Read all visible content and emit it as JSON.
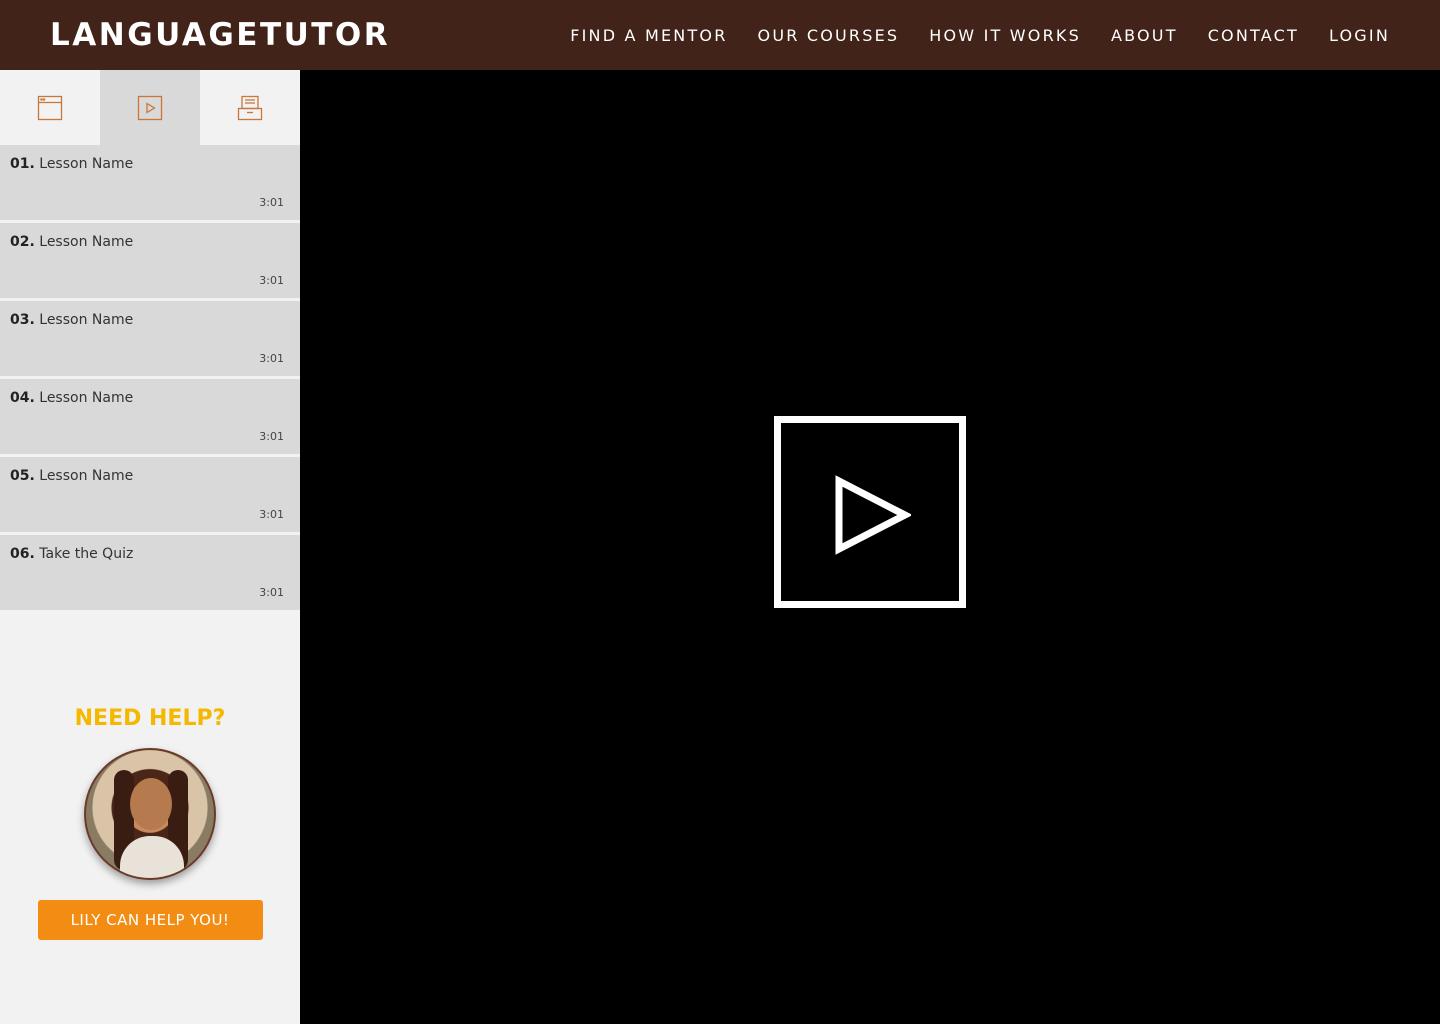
{
  "header": {
    "brand": "LANGUAGETUTOR",
    "nav": [
      "FIND A MENTOR",
      "OUR COURSES",
      "HOW IT WORKS",
      "ABOUT",
      "CONTACT",
      "LOGIN"
    ]
  },
  "sidebar": {
    "tabs": [
      {
        "icon": "browser-window-icon",
        "active": false
      },
      {
        "icon": "video-play-icon",
        "active": true
      },
      {
        "icon": "document-stack-icon",
        "active": false
      }
    ],
    "lessons": [
      {
        "number": "01.",
        "name": "Lesson Name",
        "duration": "3:01"
      },
      {
        "number": "02.",
        "name": "Lesson Name",
        "duration": "3:01"
      },
      {
        "number": "03.",
        "name": "Lesson Name",
        "duration": "3:01"
      },
      {
        "number": "04.",
        "name": "Lesson Name",
        "duration": "3:01"
      },
      {
        "number": "05.",
        "name": "Lesson Name",
        "duration": "3:01"
      },
      {
        "number": "06.",
        "name": "Take the Quiz",
        "duration": "3:01"
      }
    ],
    "help": {
      "title": "NEED HELP?",
      "button_label": "LILY CAN HELP YOU!"
    }
  },
  "colors": {
    "header_bg": "#41231a",
    "accent_orange": "#f28c12",
    "help_title": "#f5b800",
    "icon_color": "#c8763a"
  },
  "video": {
    "icon": "play-icon"
  }
}
